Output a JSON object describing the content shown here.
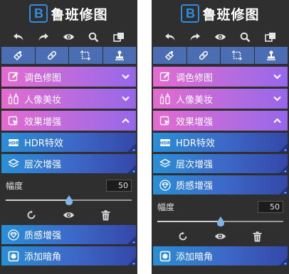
{
  "brand": {
    "logo_letter": "B",
    "name": "鲁班修图"
  },
  "toolbar": {
    "items": [
      {
        "icon": "undo-icon"
      },
      {
        "icon": "redo-icon"
      },
      {
        "icon": "eye-icon"
      },
      {
        "icon": "zoom-icon"
      },
      {
        "icon": "compare-icon"
      }
    ]
  },
  "tabs": [
    {
      "icon": "eraser-icon"
    },
    {
      "icon": "bandage-icon"
    },
    {
      "icon": "crop-icon"
    },
    {
      "icon": "stamp-icon"
    }
  ],
  "menus": [
    {
      "label": "调色修图",
      "icon": "edit-icon",
      "state": "collapsed"
    },
    {
      "label": "人像美妆",
      "icon": "portrait-icon",
      "state": "collapsed"
    },
    {
      "label": "效果增强",
      "icon": "enhance-icon",
      "state": "expanded"
    }
  ],
  "left_panel": {
    "effects_top": [
      {
        "label": "HDR特效",
        "icon": "hdr-icon"
      },
      {
        "label": "层次增强",
        "icon": "layers-icon"
      }
    ],
    "slider": {
      "label": "幅度",
      "value": "50",
      "fraction": 0.5
    },
    "effects_bottom": [
      {
        "label": "质感增强",
        "icon": "diamond-icon"
      },
      {
        "label": "添加暗角",
        "icon": "vignette-icon"
      }
    ]
  },
  "right_panel": {
    "effects_top": [
      {
        "label": "HDR特效",
        "icon": "hdr-icon"
      },
      {
        "label": "层次增强",
        "icon": "layers-icon"
      },
      {
        "label": "质感增强",
        "icon": "diamond-icon"
      }
    ],
    "slider": {
      "label": "幅度",
      "value": "50",
      "fraction": 0.5
    },
    "effects_bottom": [
      {
        "label": "添加暗角",
        "icon": "vignette-icon"
      }
    ]
  },
  "colors": {
    "panel_bg": "#2f2f2f",
    "menu_gradient_start": "#e46bd0",
    "menu_gradient_end": "#9667ea",
    "effect_gradient_start": "#2a8fd6",
    "effect_gradient_end": "#3448a8",
    "tab_bg": "#4a6db3",
    "brand_blue": "#2f8ee0",
    "slider_thumb": "#7fb6e6"
  }
}
